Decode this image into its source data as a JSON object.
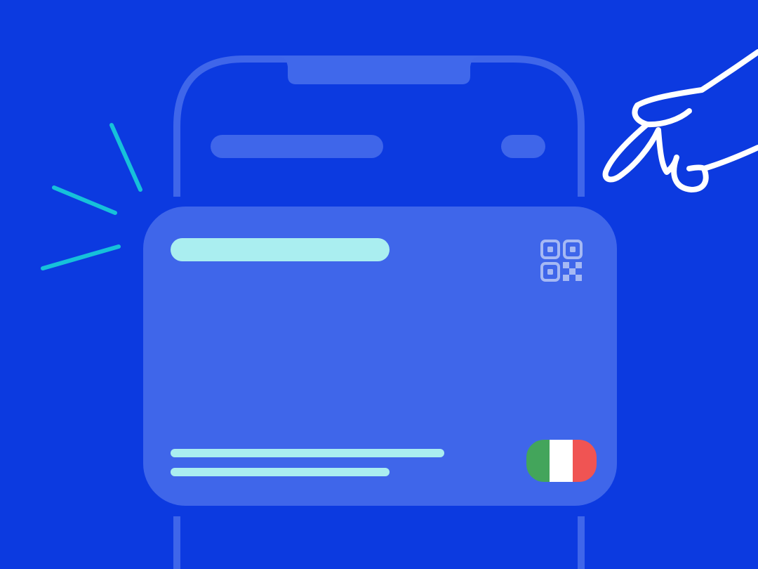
{
  "colors": {
    "background": "#0C3AE0",
    "phone_outline": "#3F66EA",
    "phone_notch": "#4068EB",
    "card": "#3F66EA",
    "card_placeholder": "#AAEEF0",
    "qr_code": "#A6B9F4",
    "spark_lines": "#16C1DA",
    "hand_outline": "#FFFFFF",
    "flag_green": "#43A55B",
    "flag_white": "#FFFFFF",
    "flag_red": "#F05453"
  },
  "icons": {
    "qr": "qr-code-icon",
    "flag": "italy-flag-icon",
    "hand": "pointing-hand-icon",
    "spark": "spark-lines-icon"
  }
}
